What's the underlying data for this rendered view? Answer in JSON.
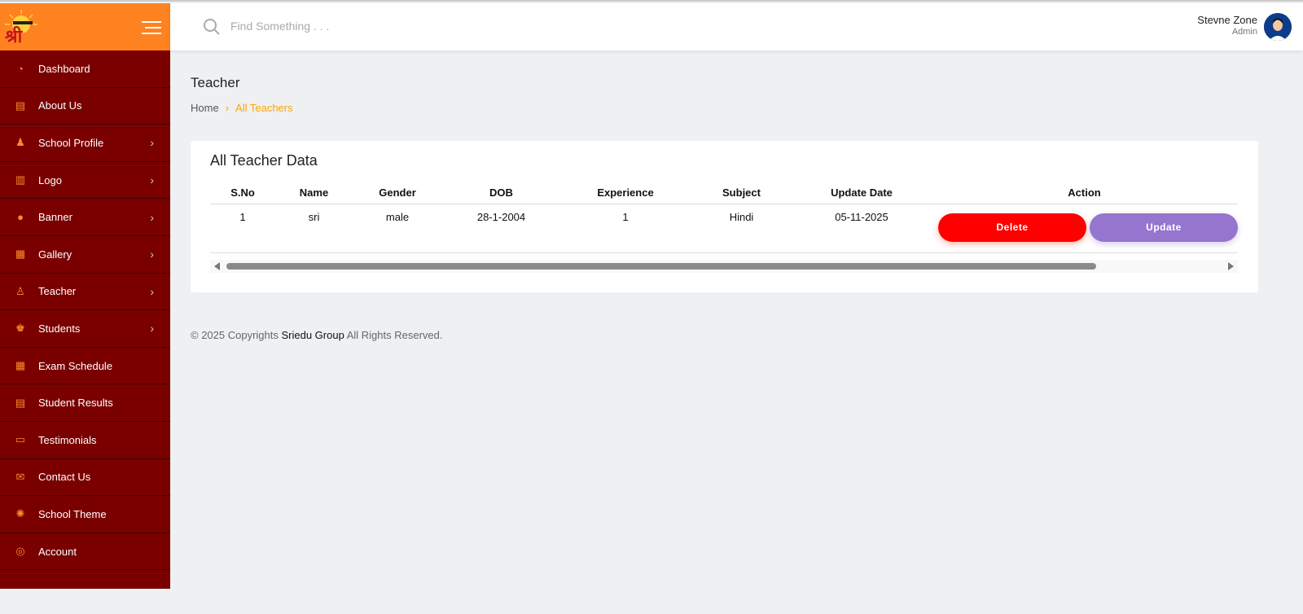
{
  "brand": {
    "logo_text": "श्री"
  },
  "search": {
    "placeholder": "Find Something . . ."
  },
  "user": {
    "name": "Stevne Zone",
    "role": "Admin"
  },
  "sidebar": {
    "items": [
      {
        "label": "Dashboard",
        "icon": "speedometer-icon",
        "glyph": "◔",
        "chevron": false
      },
      {
        "label": "About Us",
        "icon": "book-icon",
        "glyph": "▤",
        "chevron": false
      },
      {
        "label": "School Profile",
        "icon": "users-icon",
        "glyph": "♟",
        "chevron": true
      },
      {
        "label": "Logo",
        "icon": "document-icon",
        "glyph": "▥",
        "chevron": true
      },
      {
        "label": "Banner",
        "icon": "globe-icon",
        "glyph": "●",
        "chevron": true
      },
      {
        "label": "Gallery",
        "icon": "building-icon",
        "glyph": "▦",
        "chevron": true
      },
      {
        "label": "Teacher",
        "icon": "teacher-icon",
        "glyph": "♙",
        "chevron": true
      },
      {
        "label": "Students",
        "icon": "students-icon",
        "glyph": "♚",
        "chevron": true
      },
      {
        "label": "Exam Schedule",
        "icon": "calendar-icon",
        "glyph": "▦",
        "chevron": false
      },
      {
        "label": "Student Results",
        "icon": "results-icon",
        "glyph": "▤",
        "chevron": false
      },
      {
        "label": "Testimonials",
        "icon": "chat-icon",
        "glyph": "▭",
        "chevron": false
      },
      {
        "label": "Contact Us",
        "icon": "mail-icon",
        "glyph": "✉",
        "chevron": false
      },
      {
        "label": "School Theme",
        "icon": "gear-icon",
        "glyph": "✺",
        "chevron": false
      },
      {
        "label": "Account",
        "icon": "user-circle-icon",
        "glyph": "◎",
        "chevron": false
      }
    ]
  },
  "page": {
    "title": "Teacher",
    "breadcrumb": {
      "home": "Home",
      "current": "All Teachers"
    }
  },
  "table": {
    "title": "All Teacher Data",
    "headers": [
      "S.No",
      "Name",
      "Gender",
      "DOB",
      "Experience",
      "Subject",
      "Update Date",
      "Action"
    ],
    "rows": [
      {
        "sno": "1",
        "name": "sri",
        "gender": "male",
        "dob": "28-1-2004",
        "experience": "1",
        "subject": "Hindi",
        "update_date": "05-11-2025"
      }
    ],
    "delete_label": "Delete",
    "update_label": "Update"
  },
  "footer": {
    "prefix": "© 2025 Copyrights ",
    "company": "Sriedu Group",
    "suffix": " All Rights Reserved."
  },
  "colors": {
    "brand": "#ff8220",
    "sidebar": "#7a0000",
    "accent": "#ffa500",
    "delete": "#ff0000",
    "update": "#9575cd"
  }
}
